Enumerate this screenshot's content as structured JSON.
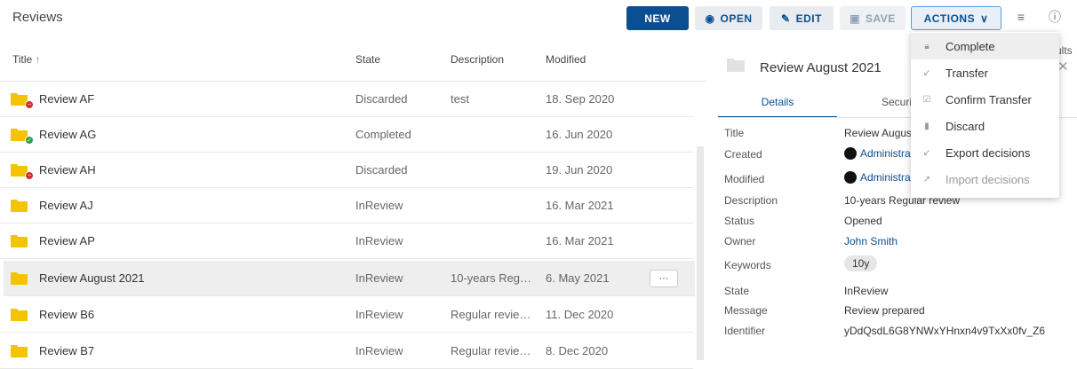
{
  "header": {
    "title": "Reviews",
    "buttons": {
      "new": "NEW",
      "open": "OPEN",
      "edit": "EDIT",
      "save": "SAVE",
      "actions": "ACTIONS"
    },
    "clipped_results_text": "ults"
  },
  "table": {
    "columns": {
      "title": "Title",
      "state": "State",
      "description": "Description",
      "modified": "Modified"
    },
    "sort_indicator": "↑",
    "rows": [
      {
        "title": "Review AF",
        "state": "Discarded",
        "description": "test",
        "modified": "18. Sep 2020",
        "status": "discarded"
      },
      {
        "title": "Review AG",
        "state": "Completed",
        "description": "",
        "modified": "16. Jun 2020",
        "status": "completed"
      },
      {
        "title": "Review AH",
        "state": "Discarded",
        "description": "",
        "modified": "19. Jun 2020",
        "status": "discarded"
      },
      {
        "title": "Review AJ",
        "state": "InReview",
        "description": "",
        "modified": "16. Mar 2021",
        "status": ""
      },
      {
        "title": "Review AP",
        "state": "InReview",
        "description": "",
        "modified": "16. Mar 2021",
        "status": ""
      },
      {
        "title": "Review August 2021",
        "state": "InReview",
        "description": "10-years Regul...",
        "modified": "6. May 2021",
        "status": "",
        "selected": true
      },
      {
        "title": "Review B6",
        "state": "InReview",
        "description": "Regular review ...",
        "modified": "11. Dec 2020",
        "status": ""
      },
      {
        "title": "Review B7",
        "state": "InReview",
        "description": "Regular review ...",
        "modified": "8. Dec 2020",
        "status": ""
      }
    ],
    "more_button": "···"
  },
  "details": {
    "title": "Review August 2021",
    "tabs": {
      "details": "Details",
      "security": "Securit"
    },
    "properties": {
      "title_label": "Title",
      "title_value": "Review August",
      "created_label": "Created",
      "created_value": "Administra",
      "modified_label": "Modified",
      "modified_value": "Administra",
      "description_label": "Description",
      "description_value": "10-years Regular review",
      "status_label": "Status",
      "status_value": "Opened",
      "owner_label": "Owner",
      "owner_value": "John Smith",
      "keywords_label": "Keywords",
      "keywords_value": "10y",
      "state_label": "State",
      "state_value": "InReview",
      "message_label": "Message",
      "message_value": "Review prepared",
      "identifier_label": "Identifier",
      "identifier_value": "yDdQsdL6G8YNWxYHnxn4v9TxXx0fv_Z6"
    }
  },
  "actions_menu": {
    "items": [
      {
        "label": "Complete",
        "icon": "lock-icon"
      },
      {
        "label": "Transfer",
        "icon": "arrow-down-left-icon"
      },
      {
        "label": "Confirm Transfer",
        "icon": "checkbox-icon"
      },
      {
        "label": "Discard",
        "icon": "trash-icon"
      },
      {
        "label": "Export decisions",
        "icon": "arrow-down-left-icon"
      },
      {
        "label": "Import decisions",
        "icon": "arrow-up-right-icon",
        "disabled": true
      }
    ]
  },
  "colors": {
    "primary": "#0b4f91",
    "folder": "#f5c400",
    "discarded": "#d32f2f",
    "completed": "#2e9e44"
  }
}
